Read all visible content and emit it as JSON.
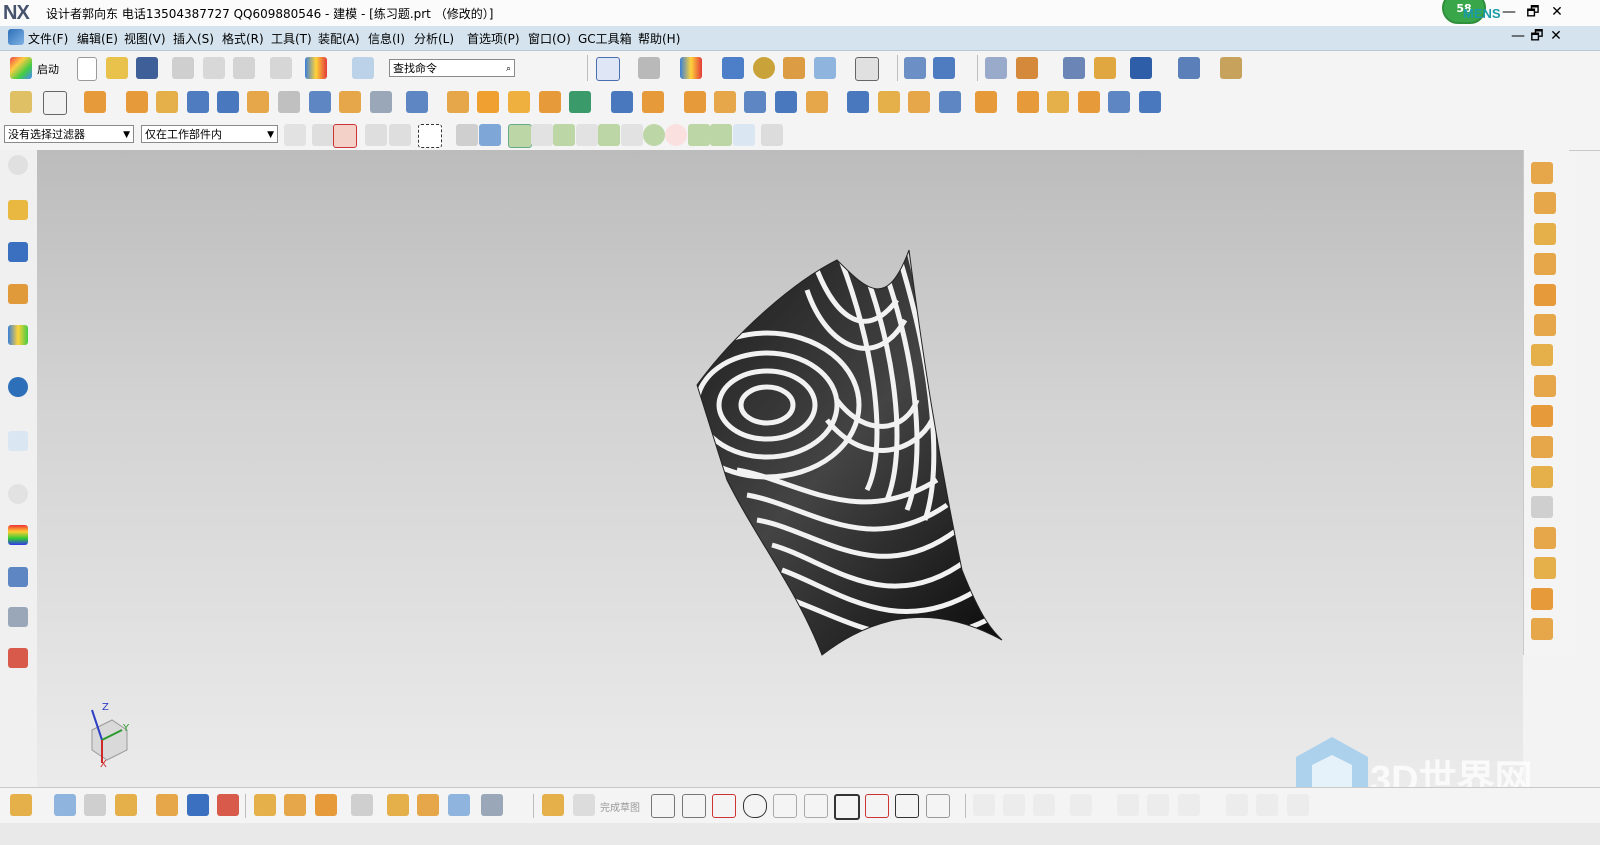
{
  "window": {
    "logo": "NX",
    "title": "设计者郭向东  电话13504387727  QQ609880546 - 建模 - [练习题.prt （修改的）]",
    "brand": "SIEMENS",
    "brand_visible": "MENS",
    "notification_count": "58",
    "controls": [
      "—",
      "🗗",
      "✕"
    ]
  },
  "menubar": {
    "items": [
      "文件(F)",
      "编辑(E)",
      "视图(V)",
      "插入(S)",
      "格式(R)",
      "工具(T)",
      "装配(A)",
      "信息(I)",
      "分析(L)",
      "首选项(P)",
      "窗口(O)",
      "GC工具箱",
      "帮助(H)"
    ],
    "doc_controls": [
      "—",
      "🗗",
      "✕"
    ]
  },
  "toolbar1": {
    "start_label": "启动",
    "search_placeholder": "查找命令"
  },
  "selection_bar": {
    "filter_value": "没有选择过滤器",
    "scope_value": "仅在工作部件内"
  },
  "sketch_toolbar": {
    "finish_sketch_label": "完成草图"
  },
  "watermark": {
    "text": "3D世界网"
  },
  "triad": {
    "x_label": "X",
    "y_label": "Y",
    "z_label": "Z"
  },
  "colors": {
    "menubar_bg": "#d4e3ee",
    "viewport_top": "#bcbcbc",
    "viewport_bottom": "#ebebeb",
    "badge": "#3aa64a",
    "brand": "#1a9aa8"
  }
}
